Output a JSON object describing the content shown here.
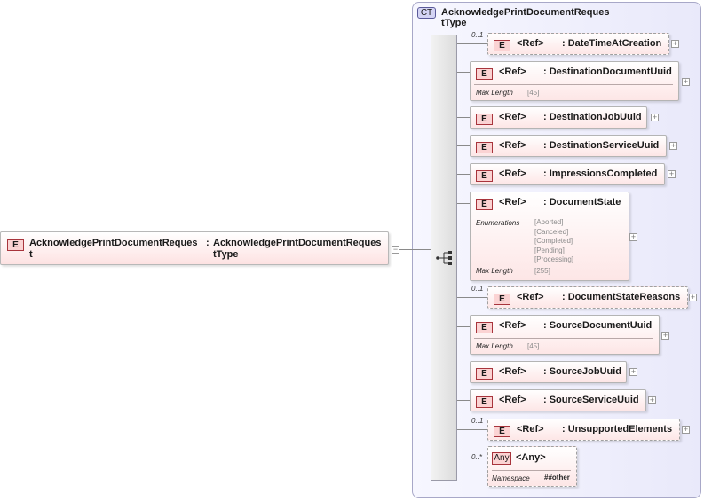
{
  "root": {
    "badge": "E",
    "name_line1": "AcknowledgePrintDocumentReques",
    "name_line2": "t",
    "colon": ":",
    "type_line1": "AcknowledgePrintDocumentReques",
    "type_line2": "tType"
  },
  "complex_type": {
    "badge": "CT",
    "title_line1": "AcknowledgePrintDocumentReques",
    "title_line2": "tType"
  },
  "sequence": {
    "icon": "sequence-icon"
  },
  "children": [
    {
      "badge": "E",
      "ref": "<Ref>",
      "name": ": DateTimeAtCreation",
      "occurrence": "0..1"
    },
    {
      "badge": "E",
      "ref": "<Ref>",
      "name": ": DestinationDocumentUuid",
      "facet_label": "Max Length",
      "facet_value": "[45]"
    },
    {
      "badge": "E",
      "ref": "<Ref>",
      "name": ": DestinationJobUuid"
    },
    {
      "badge": "E",
      "ref": "<Ref>",
      "name": ": DestinationServiceUuid"
    },
    {
      "badge": "E",
      "ref": "<Ref>",
      "name": ": ImpressionsCompleted"
    },
    {
      "badge": "E",
      "ref": "<Ref>",
      "name": ": DocumentState",
      "enum_label": "Enumerations",
      "enums": [
        "[Aborted]",
        "[Canceled]",
        "[Completed]",
        "[Pending]",
        "[Processing]"
      ],
      "facet_label": "Max Length",
      "facet_value": "[255]"
    },
    {
      "badge": "E",
      "ref": "<Ref>",
      "name": ": DocumentStateReasons",
      "occurrence": "0..1"
    },
    {
      "badge": "E",
      "ref": "<Ref>",
      "name": ": SourceDocumentUuid",
      "facet_label": "Max Length",
      "facet_value": "[45]"
    },
    {
      "badge": "E",
      "ref": "<Ref>",
      "name": ": SourceJobUuid"
    },
    {
      "badge": "E",
      "ref": "<Ref>",
      "name": ": SourceServiceUuid"
    },
    {
      "badge": "E",
      "ref": "<Ref>",
      "name": ": UnsupportedElements",
      "occurrence": "0..1"
    }
  ],
  "any": {
    "badge": "Any",
    "label": "<Any>",
    "occurrence": "0..*",
    "ns_label": "Namespace",
    "ns_value": "##other"
  },
  "expander": {
    "plus": "+",
    "minus": "−"
  },
  "colors": {
    "element_border": "#a8343c",
    "element_fill": "#fbd3d3",
    "complex_type_fill": "#e9e9fa",
    "connector": "#8a8a8a"
  }
}
